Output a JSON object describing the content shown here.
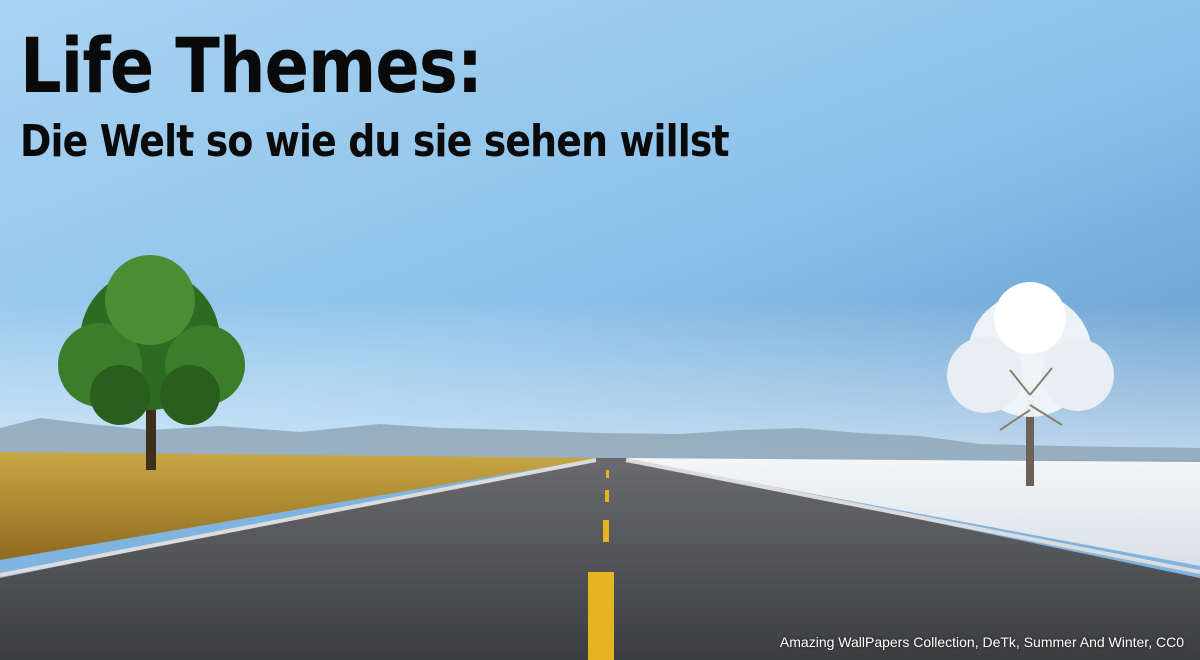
{
  "headline": {
    "title": "Life Themes:",
    "subtitle": "Die Welt so wie du sie sehen willst"
  },
  "credit": "Amazing WallPapers Collection, DeTk, Summer And Winter, CC0",
  "scene": {
    "left_tree": "summer-tree",
    "right_tree": "winter-tree",
    "sky_color": "#8cc2ea",
    "grass_color": "#b08a2e",
    "snow_color": "#eef3f6",
    "road_color": "#4a4b4e",
    "center_line_color": "#e6b422"
  }
}
